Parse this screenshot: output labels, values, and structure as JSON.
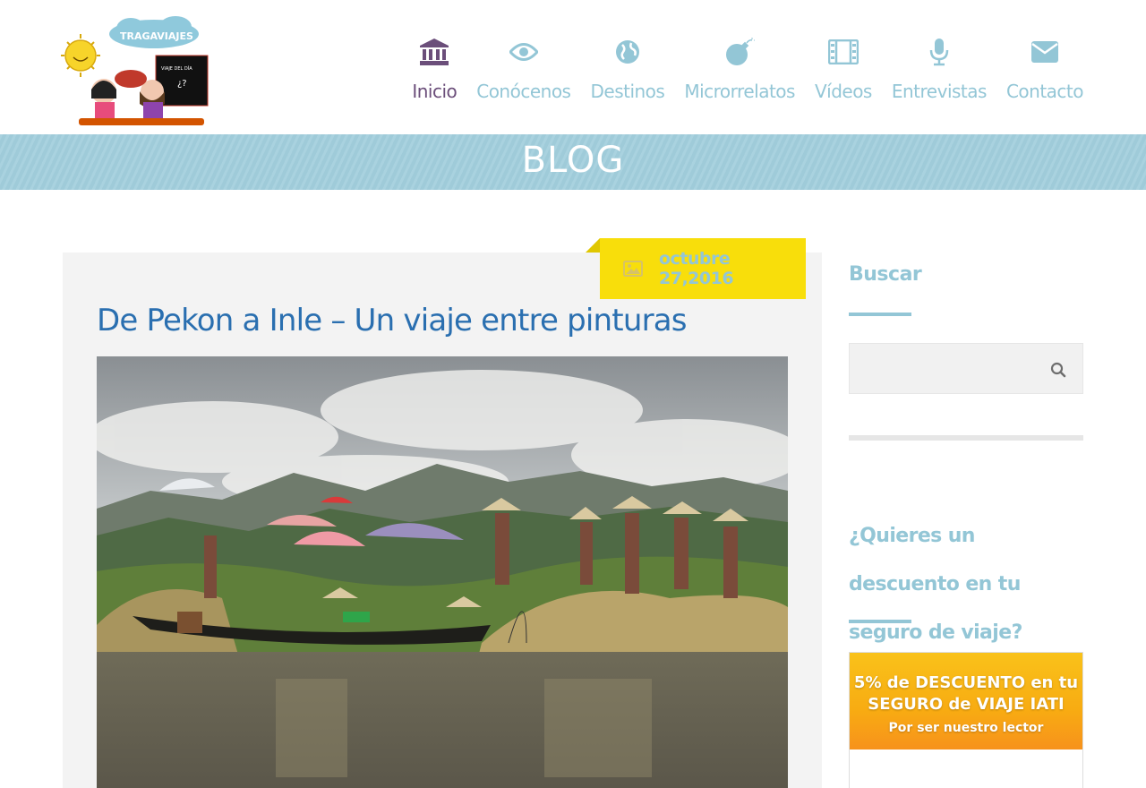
{
  "brand": {
    "logo_text": "TRAGAVIAJES",
    "board_text": "VIAJE DEL DÍA ¿?"
  },
  "nav": {
    "items": [
      {
        "label": "Inicio",
        "icon": "bank-icon",
        "active": true
      },
      {
        "label": "Conócenos",
        "icon": "eye-icon",
        "active": false
      },
      {
        "label": "Destinos",
        "icon": "globe-icon",
        "active": false
      },
      {
        "label": "Microrrelatos",
        "icon": "bomb-icon",
        "active": false
      },
      {
        "label": "Vídeos",
        "icon": "film-icon",
        "active": false
      },
      {
        "label": "Entrevistas",
        "icon": "microphone-icon",
        "active": false
      },
      {
        "label": "Contacto",
        "icon": "envelope-icon",
        "active": false
      }
    ],
    "color": "#93c6d6",
    "active_color": "#6b4e7a"
  },
  "banner": {
    "title": "BLOG"
  },
  "post": {
    "date": "octubre 27,2016",
    "date_icon": "image-icon",
    "title": "De Pekon a Inle – Un viaje entre pinturas",
    "title_color": "#2a6fb0"
  },
  "sidebar": {
    "search_title": "Buscar",
    "search_placeholder": "",
    "search_icon": "search-icon",
    "discount_title": "¿Quieres un descuento en tu seguro de viaje?",
    "promo": {
      "line1": "5% de DESCUENTO en tu SEGURO de VIAJE IATI",
      "line2": "Por ser nuestro lector"
    }
  },
  "colors": {
    "accent": "#93c6d6",
    "date_bg": "#f8de0b",
    "banner_bg": "#a9d2df"
  }
}
